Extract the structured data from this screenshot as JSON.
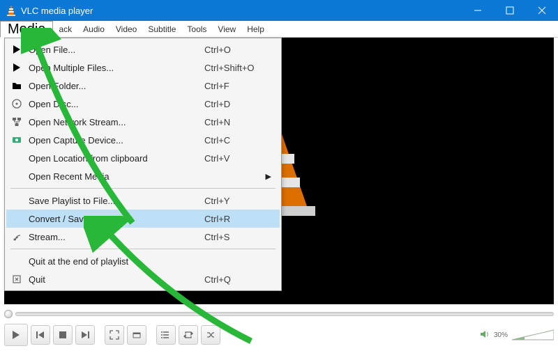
{
  "window": {
    "title": "VLC media player"
  },
  "menubar": {
    "items": [
      "Media",
      "ack",
      "Audio",
      "Video",
      "Subtitle",
      "Tools",
      "View",
      "Help"
    ]
  },
  "media_menu": {
    "open_file": {
      "label": "Open File...",
      "shortcut": "Ctrl+O"
    },
    "open_multiple": {
      "label": "Open Multiple Files...",
      "shortcut": "Ctrl+Shift+O"
    },
    "open_folder": {
      "label": "Open Folder...",
      "shortcut": "Ctrl+F"
    },
    "open_disc": {
      "label": "Open Disc...",
      "shortcut": "Ctrl+D"
    },
    "open_network": {
      "label": "Open Network Stream...",
      "shortcut": "Ctrl+N"
    },
    "open_capture": {
      "label": "Open Capture Device...",
      "shortcut": "Ctrl+C"
    },
    "open_clipboard": {
      "label": "Open Location from clipboard",
      "shortcut": "Ctrl+V"
    },
    "open_recent": {
      "label": "Open Recent Media",
      "shortcut": ""
    },
    "save_playlist": {
      "label": "Save Playlist to File...",
      "shortcut": "Ctrl+Y"
    },
    "convert_save": {
      "label": "Convert / Save...",
      "shortcut": "Ctrl+R"
    },
    "stream": {
      "label": "Stream...",
      "shortcut": "Ctrl+S"
    },
    "quit_end": {
      "label": "Quit at the end of playlist",
      "shortcut": ""
    },
    "quit": {
      "label": "Quit",
      "shortcut": "Ctrl+Q"
    }
  },
  "playback": {
    "volume_label": "30%"
  },
  "colors": {
    "titlebar": "#0A78D4",
    "menu_highlight": "#BDE0F7",
    "annotation_arrow": "#29B73A"
  }
}
